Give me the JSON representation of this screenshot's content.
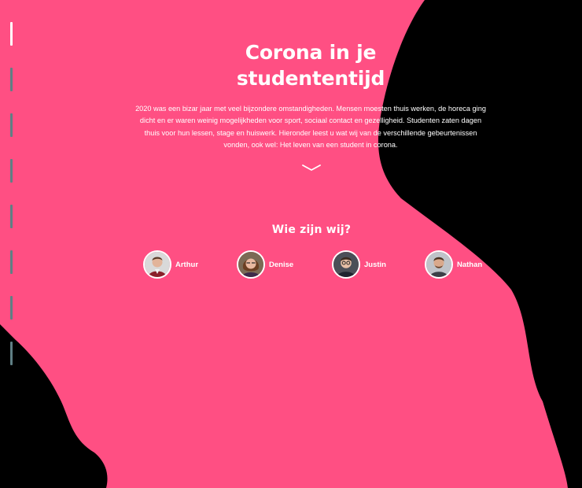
{
  "theme": {
    "background": "#000000",
    "accent": "#ff4f83",
    "text": "#ffffff",
    "progress_track": "#5f7f84",
    "progress_active": "#ffffff"
  },
  "hero": {
    "title": "Corona in je studententijd",
    "intro": "2020 was een bizar jaar met veel bijzondere omstandigheden. Mensen moesten thuis werken, de horeca ging dicht en er waren weinig mogelijkheden voor sport, sociaal contact en gezelligheid. Studenten zaten dagen thuis voor hun lessen, stage en huiswerk. Hieronder leest u wat wij van de verschillende gebeurtenissen vonden, ook wel: Het leven van een student in corona.",
    "scroll_icon": "chevron-down-icon"
  },
  "team": {
    "heading": "Wie zijn wij?",
    "members": [
      {
        "name": "Arthur"
      },
      {
        "name": "Denise"
      },
      {
        "name": "Justin"
      },
      {
        "name": "Nathan"
      }
    ]
  },
  "progress": {
    "segments": 8,
    "active_segment": 1
  }
}
